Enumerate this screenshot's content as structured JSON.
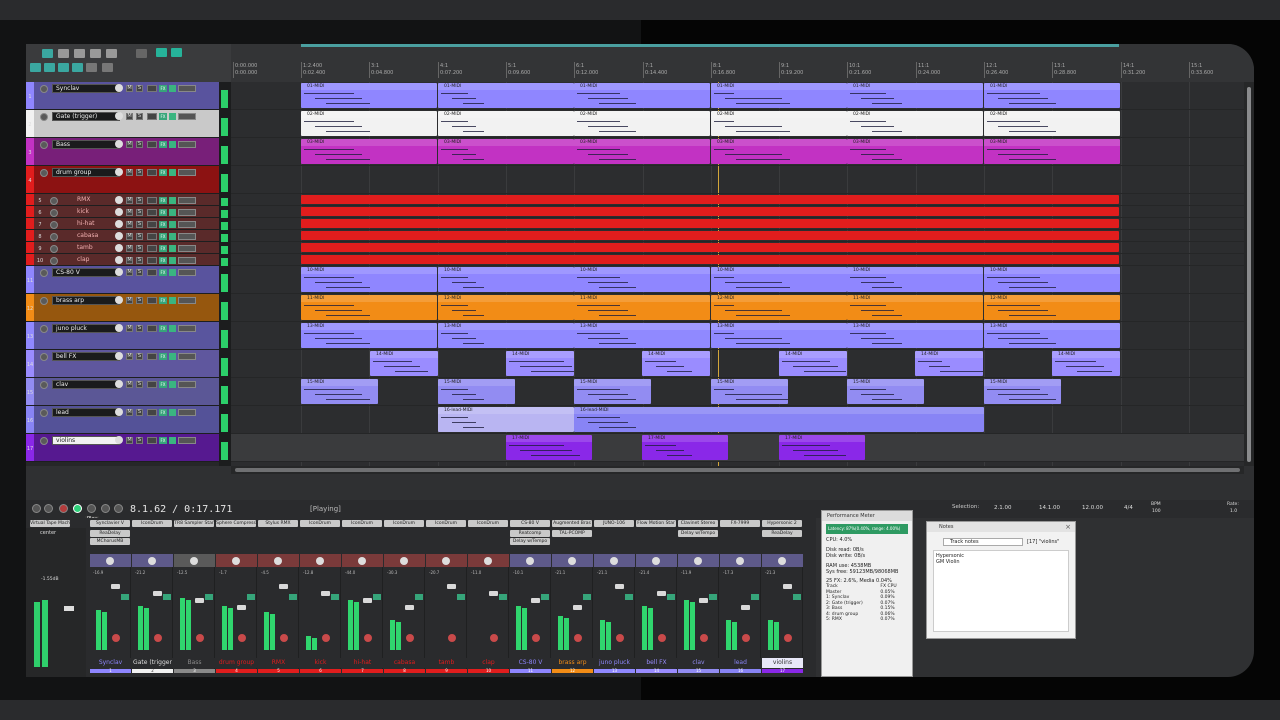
{
  "colors": {
    "synclav": "#8f86ff",
    "gate": "#f2f2f2",
    "bass": "#c232c3",
    "drum": "#e11d1d",
    "cs80v": "#8f86ff",
    "brass": "#f28c16",
    "juno": "#9089ff",
    "bellfx": "#9a8cff",
    "clav": "#928cf2",
    "lead": "#8884f5",
    "violins": "#8a28e8"
  },
  "tracks": [
    {
      "num": "1",
      "name": "Synclav"
    },
    {
      "num": "2",
      "name": "Gate (trigger)"
    },
    {
      "num": "3",
      "name": "Bass"
    },
    {
      "num": "4",
      "name": "drum group"
    },
    {
      "num": "5",
      "name": "RMX"
    },
    {
      "num": "6",
      "name": "kick"
    },
    {
      "num": "7",
      "name": "hi-hat"
    },
    {
      "num": "8",
      "name": "cabasa"
    },
    {
      "num": "9",
      "name": "tamb"
    },
    {
      "num": "10",
      "name": "clap"
    },
    {
      "num": "11",
      "name": "CS-80 V"
    },
    {
      "num": "12",
      "name": "brass arp"
    },
    {
      "num": "13",
      "name": "juno pluck"
    },
    {
      "num": "14",
      "name": "bell FX"
    },
    {
      "num": "15",
      "name": "clav"
    },
    {
      "num": "16",
      "name": "lead"
    },
    {
      "num": "17",
      "name": "violins"
    }
  ],
  "track_buttons": {
    "mute": "M",
    "solo": "S",
    "fx": "FX"
  },
  "items": {
    "synclav": "01-MIDI",
    "gate": "02-MIDI",
    "bass": "03-MIDI",
    "cs80v": "10-MIDI",
    "brass": "11-MIDI",
    "brass2": "12-MIDI",
    "juno": "13-MIDI",
    "bellfx": "14-MIDI",
    "clav": "15-MIDI",
    "lead": "16-lead-MIDI",
    "violins": "17-MIDI"
  },
  "ruler": {
    "marks": [
      "0:00.000",
      "1:2.400",
      "3:1",
      "4:1",
      "5:1",
      "6:1",
      "7:1",
      "8:1",
      "9:1",
      "10:1",
      "11:1",
      "12:1",
      "13:1",
      "14:1",
      "15:1"
    ],
    "times": [
      "0:00.000",
      "0:02.400",
      "0:04.800",
      "0:07.200",
      "0:09.600",
      "0:12.000",
      "0:14.400",
      "0:16.800",
      "0:19.200",
      "0:21.600",
      "0:24.000",
      "0:26.400",
      "0:28.800",
      "0:31.200",
      "0:33.600"
    ]
  },
  "transport": {
    "position": "8.1.62 / 0:17.171",
    "status": "[Playing]",
    "play_tooltip": "Play",
    "selection_label": "Selection:",
    "sel_start": "2.1.00",
    "sel_end": "14.1.00",
    "sel_len": "12.0.00",
    "timesig": "4/4",
    "bpm_label": "BPM",
    "bpm": "100",
    "rate_label": "Rate:",
    "rate": "1.0"
  },
  "fx_slots": [
    {
      "label": "Virtual Tape Machine"
    },
    {
      "label": "Synclavier V"
    },
    {
      "label": "IconDrum"
    },
    {
      "label": "TR8 Sampler Star"
    },
    {
      "label": "Sphere Compress"
    },
    {
      "label": "Stylus RMX"
    },
    {
      "label": "IconDrum"
    },
    {
      "label": "IconDrum"
    },
    {
      "label": "IconDrum"
    },
    {
      "label": "IconDrum"
    },
    {
      "label": "IconDrum"
    },
    {
      "label": "CS-80 V"
    },
    {
      "label": "Augmented Bras"
    },
    {
      "label": "JUNO-106"
    },
    {
      "label": "Flow Motion Star"
    },
    {
      "label": "Clavinet Stereo"
    },
    {
      "label": "FX-7999"
    },
    {
      "label": "Hypersonic 2"
    }
  ],
  "fx_slots_row2": {
    "synclav": "ReaDelay",
    "synclav3": "MChorusMB",
    "cs80": "Reatcomp",
    "cs80b": "Delay w/Tempo",
    "brass": "TAL-PCOMP",
    "clav": "Delay w/Tempo",
    "violins": "ReaDelay"
  },
  "mixer": {
    "master_label": "center",
    "master_db": "-1.55dB",
    "strips": [
      {
        "name": "Synclav",
        "num": "1",
        "db": "-16.9"
      },
      {
        "name": "Gate (trigger",
        "num": "2",
        "db": "-21.2"
      },
      {
        "name": "Bass",
        "num": "3",
        "db": "-12.5"
      },
      {
        "name": "drum group",
        "num": "4",
        "db": "-1.7"
      },
      {
        "name": "RMX",
        "num": "5",
        "db": "-4.5"
      },
      {
        "name": "kick",
        "num": "6",
        "db": "-12.8"
      },
      {
        "name": "hi-hat",
        "num": "7",
        "db": "-44.0"
      },
      {
        "name": "cabasa",
        "num": "8",
        "db": "-30.3"
      },
      {
        "name": "tamb",
        "num": "9",
        "db": "-20.7"
      },
      {
        "name": "clap",
        "num": "10",
        "db": "-11.0"
      },
      {
        "name": "CS-80 V",
        "num": "11",
        "db": "-10.1"
      },
      {
        "name": "brass arp",
        "num": "12",
        "db": "-21.1"
      },
      {
        "name": "juno pluck",
        "num": "13",
        "db": "-21.1"
      },
      {
        "name": "bell FX",
        "num": "14",
        "db": "-21.4"
      },
      {
        "name": "clav",
        "num": "15",
        "db": "-11.9"
      },
      {
        "name": "lead",
        "num": "16",
        "db": "-17.3"
      },
      {
        "name": "violins",
        "num": "17",
        "db": "-21.3"
      }
    ]
  },
  "perf": {
    "title": "Performance Meter",
    "bar": "Latency: 87%(0.40%, range: 4.00%)",
    "cpu": "CPU: 4.0%",
    "disk_read": "Disk read: 0B/s",
    "disk_write": "Disk write: 0B/s",
    "ram": "RAM use: 4538MB",
    "sys": "Sys free: 59123MB/98068MB",
    "fx": "25 FX: 2.6%, Media 0.04%",
    "col_track": "Track",
    "col_cpu": "FX CPU",
    "rows": [
      {
        "t": "Master",
        "c": "0.05%"
      },
      {
        "t": "1: Synclav",
        "c": "0.09%"
      },
      {
        "t": "2: Gate (trigger)",
        "c": "0.07%"
      },
      {
        "t": "3: Bass",
        "c": "0.15%"
      },
      {
        "t": "4: drum group",
        "c": "0.06%"
      },
      {
        "t": "5: RMX",
        "c": "0.07%"
      }
    ]
  },
  "notes": {
    "title": "Notes",
    "mode": "Track notes",
    "track": "[17] \"violins\"",
    "text1": "Hypersonic",
    "text2": "GM Violin"
  }
}
